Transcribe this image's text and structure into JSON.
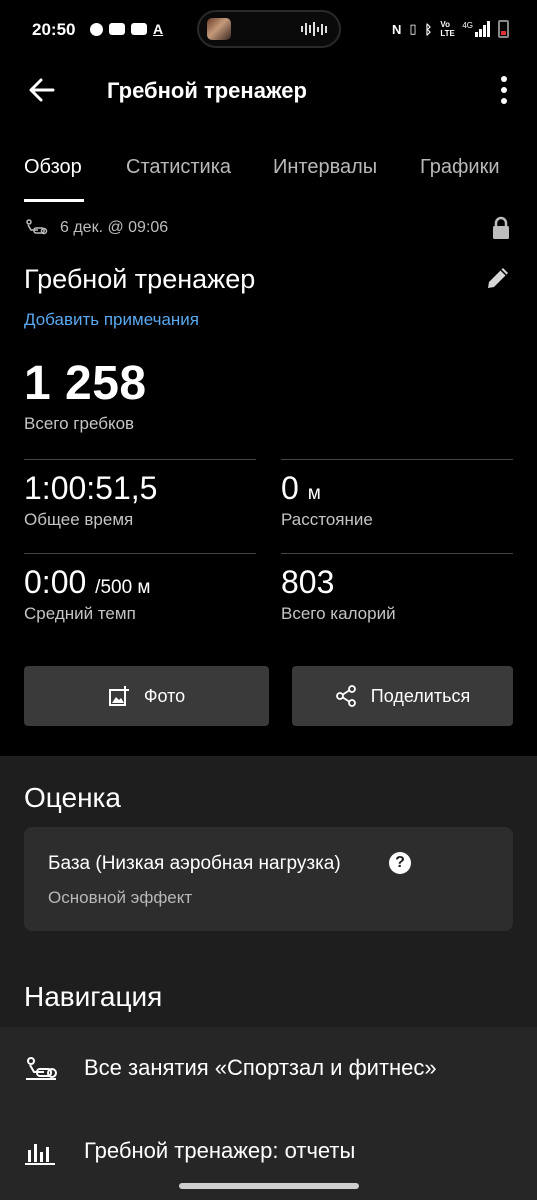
{
  "status_bar": {
    "time": "20:50",
    "a_indicator": "A",
    "volte": "Vo LTE",
    "network": "4G"
  },
  "app_bar": {
    "title": "Гребной тренажер"
  },
  "tabs": [
    {
      "label": "Обзор",
      "active": true
    },
    {
      "label": "Статистика",
      "active": false
    },
    {
      "label": "Интервалы",
      "active": false
    },
    {
      "label": "Графики",
      "active": false
    }
  ],
  "activity": {
    "date_time": "6 дек. @ 09:06",
    "name": "Гребной тренажер",
    "add_note": "Добавить примечания",
    "total_strokes": "1 258",
    "total_strokes_label": "Всего гребков"
  },
  "stats": [
    {
      "value": "1:00:51,5",
      "unit": "",
      "label": "Общее время"
    },
    {
      "value": "0",
      "unit": "м",
      "label": "Расстояние"
    },
    {
      "value": "0:00",
      "unit": "/500 м",
      "label": "Средний темп"
    },
    {
      "value": "803",
      "unit": "",
      "label": "Всего калорий"
    }
  ],
  "buttons": {
    "photo": "Фото",
    "share": "Поделиться"
  },
  "assessment": {
    "section_title": "Оценка",
    "title": "База (Низкая аэробная нагрузка)",
    "help": "?",
    "subtitle": "Основной эффект"
  },
  "navigation": {
    "section_title": "Навигация",
    "items": [
      {
        "label": "Все занятия «Спортзал и фитнес»",
        "icon": "rowing-machine-icon"
      },
      {
        "label": "Гребной тренажер: отчеты",
        "icon": "bar-chart-icon"
      }
    ]
  },
  "colors": {
    "accent_link": "#5aa9f0",
    "background": "#000000",
    "lower_background": "#1e1e1e",
    "card_background": "#2d2d2d"
  }
}
